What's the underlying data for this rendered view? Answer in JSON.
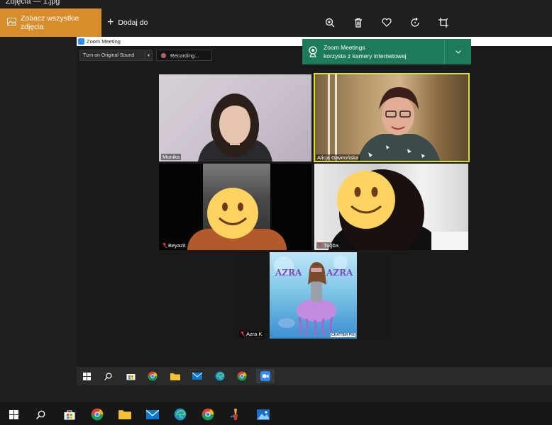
{
  "window_title": "Zdjęcia — 1.jpg",
  "toolbar": {
    "see_all_label": "Zobacz wszystkie zdjęcia",
    "add_to_label": "Dodaj do",
    "icons": [
      "zoom-in-icon",
      "delete-icon",
      "heart-icon",
      "rotate-icon",
      "crop-icon"
    ]
  },
  "zoom": {
    "title": "Zoom Meeting",
    "original_sound_label": "Turn on Original Sound",
    "recording_label": "Recording..."
  },
  "notification": {
    "title": "Zoom Meetings",
    "body": "korzysta z kamery internetowej"
  },
  "participants": [
    {
      "name": "Monika",
      "muted": false,
      "active_speaker": false
    },
    {
      "name": "Alicja Gawrońska",
      "muted": false,
      "active_speaker": true
    },
    {
      "name": "Beyazit",
      "muted": true,
      "active_speaker": false
    },
    {
      "name": "Tuğba",
      "muted": true,
      "active_speaker": false
    },
    {
      "name": "Azra K",
      "muted": true,
      "active_speaker": false
    }
  ],
  "avatar_text": {
    "left": "AZRA",
    "right": "AZRA",
    "credit": "CHATTER PIX"
  },
  "taskbar_icons": [
    "windows-start-icon",
    "search-icon",
    "store-icon",
    "chrome-icon",
    "file-explorer-icon",
    "mail-icon",
    "edge-icon",
    "chrome-icon",
    "zoom-icon"
  ],
  "outer_taskbar_icons": [
    "windows-start-icon",
    "search-icon",
    "store-icon",
    "chrome-icon",
    "file-explorer-icon",
    "mail-icon",
    "edge-icon",
    "chrome-icon",
    "paint-icon",
    "photos-icon"
  ],
  "colors": {
    "accent": "#d98c2a",
    "notification": "#1e7a5c",
    "active_speaker_border": "#d7e03a",
    "smiley": "#fcd35f"
  }
}
